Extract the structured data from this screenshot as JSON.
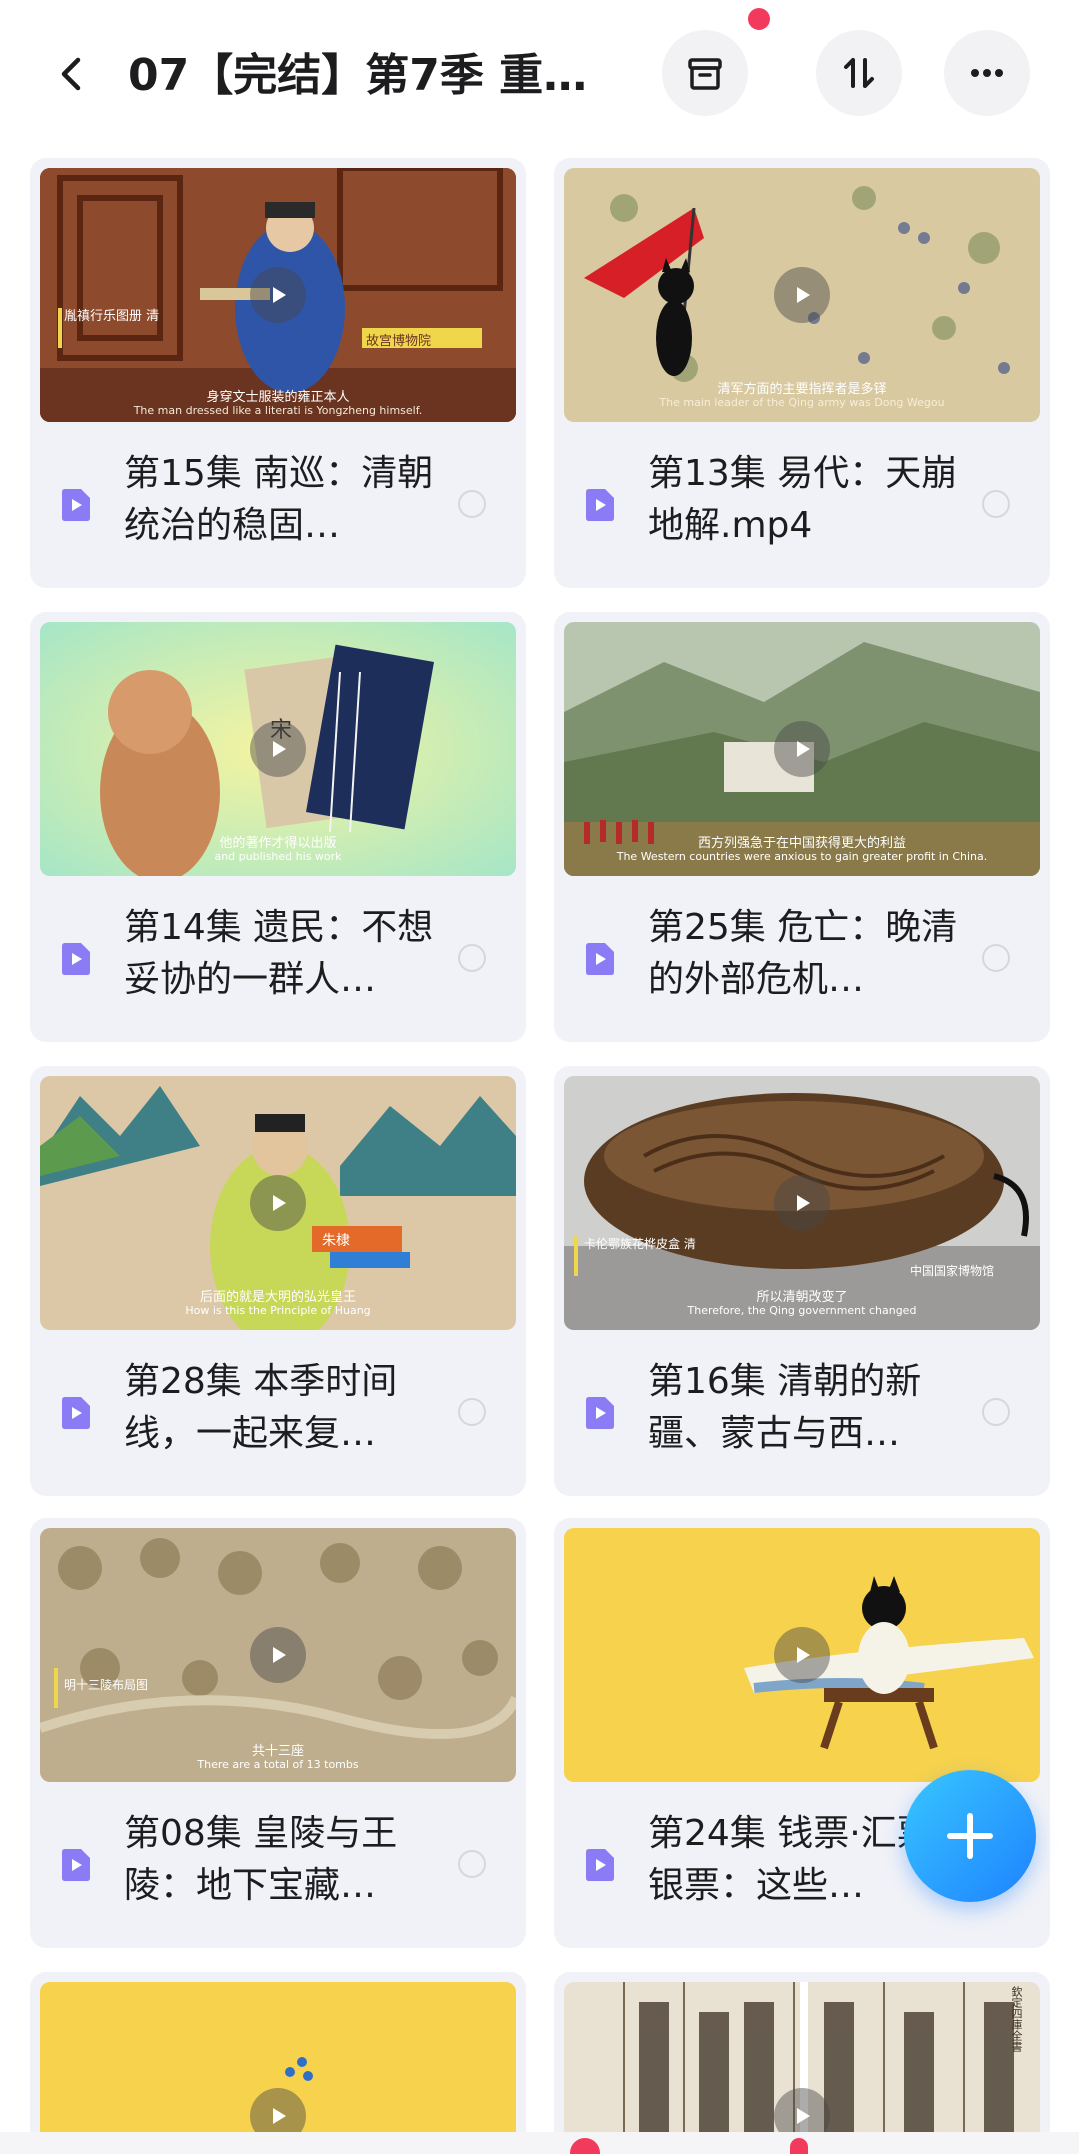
{
  "header": {
    "title": "07【完结】第7季 重…",
    "back_icon": "chevron-left-icon",
    "archive_icon": "archive-box-icon",
    "sort_icon": "sort-arrows-icon",
    "more_icon": "more-dots-icon"
  },
  "colors": {
    "accent": "#1e82ff",
    "notification": "#f23b5c",
    "file_icon": "#8b7cf6",
    "card_bg": "#f1f2f7"
  },
  "cards": [
    {
      "title": "第15集 南巡：清朝统治的稳固…",
      "thumb_caption": "身穿文士服装的雍正本人",
      "thumb_caption_en": "The man dressed like a literati is Yongzheng himself.",
      "thumb_tag": "故宫博物院",
      "thumb_side": "胤禛行乐图册 清"
    },
    {
      "title": "第13集 易代：天崩地解.mp4",
      "thumb_caption": "清军方面的主要指挥者是多铎",
      "thumb_caption_en": "The main leader of the Qing army was Dong Wegou",
      "thumb_tag": "",
      "thumb_side": ""
    },
    {
      "title": "第14集 遗民：不想妥协的一群人…",
      "thumb_caption": "他的著作才得以出版",
      "thumb_caption_en": "and published his work",
      "thumb_tag": "",
      "thumb_side": "宋"
    },
    {
      "title": "第25集 危亡：晚清的外部危机…",
      "thumb_caption": "西方列强急于在中国获得更大的利益",
      "thumb_caption_en": "The Western countries were anxious to gain greater profit in China.",
      "thumb_tag": "",
      "thumb_side": ""
    },
    {
      "title": "第28集 本季时间线，一起来复…",
      "thumb_caption": "后面的就是大明的弘光皇王",
      "thumb_caption_en": "How is this the Principle of Huang",
      "thumb_tag": "朱棣",
      "thumb_side": ""
    },
    {
      "title": "第16集 清朝的新疆、蒙古与西…",
      "thumb_caption": "所以清朝改变了",
      "thumb_caption_en": "Therefore, the Qing government changed",
      "thumb_tag": "中国国家博物馆",
      "thumb_side": "卡伦鄂族花桦皮盒 清"
    },
    {
      "title": "第08集 皇陵与王陵：地下宝藏…",
      "thumb_caption": "共十三座",
      "thumb_caption_en": "There are a total of 13 tombs",
      "thumb_tag": "",
      "thumb_side": "明十三陵布局图"
    },
    {
      "title": "第24集 钱票·汇票·银票：这些…",
      "thumb_caption": "",
      "thumb_caption_en": "",
      "thumb_tag": "",
      "thumb_side": ""
    },
    {
      "title": "",
      "thumb_caption": "",
      "thumb_caption_en": "",
      "thumb_tag": "",
      "thumb_side": ""
    },
    {
      "title": "",
      "thumb_caption": "",
      "thumb_caption_en": "",
      "thumb_tag": "",
      "thumb_side": "欽定四庫全書"
    }
  ],
  "fab": {
    "icon": "plus-icon"
  }
}
